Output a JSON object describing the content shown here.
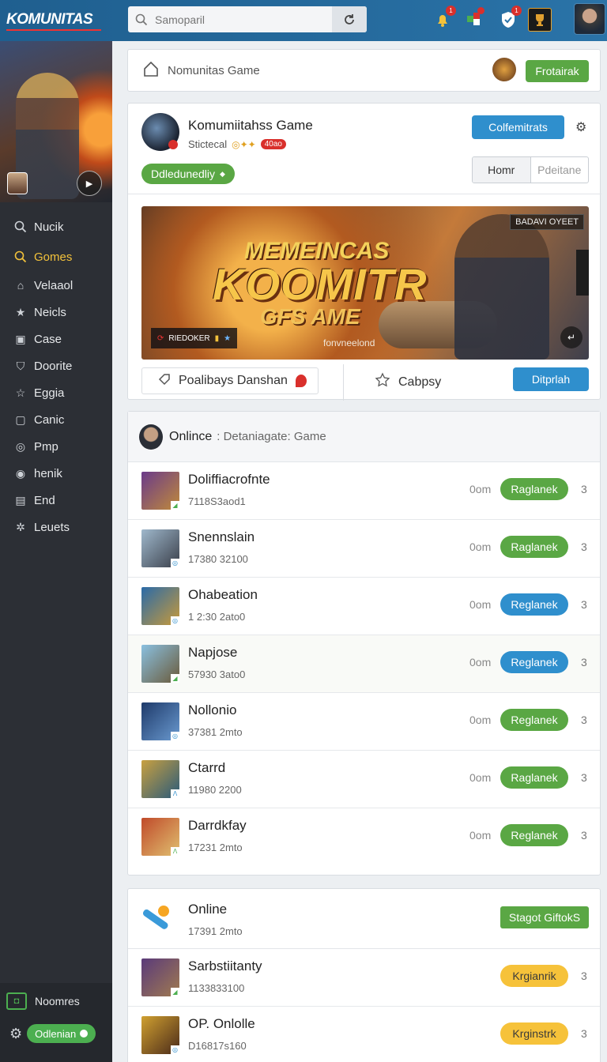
{
  "topbar": {
    "logo": "KOMUNITAS",
    "search_placeholder": "Samoparil",
    "icons": [
      "bell-icon",
      "puzzle-icon",
      "shield-icon",
      "trophy-icon"
    ],
    "badges": [
      "1",
      "",
      "1",
      ""
    ]
  },
  "sidebar": {
    "items": [
      {
        "label": "Nucik",
        "icon": "search-icon"
      },
      {
        "label": "Gomes",
        "icon": "search-icon",
        "active": true
      },
      {
        "label": "Velaaol",
        "icon": "home-icon"
      },
      {
        "label": "Neicls",
        "icon": "star-icon"
      },
      {
        "label": "Case",
        "icon": "box-icon"
      },
      {
        "label": "Doorite",
        "icon": "shield-icon"
      },
      {
        "label": "Eggia",
        "icon": "star-outline-icon"
      },
      {
        "label": "Canic",
        "icon": "square-icon"
      },
      {
        "label": "Pmp",
        "icon": "circle-icon"
      },
      {
        "label": "henik",
        "icon": "circle-icon"
      },
      {
        "label": "End",
        "icon": "briefcase-icon"
      },
      {
        "label": "Leuets",
        "icon": "sparkle-icon"
      }
    ],
    "bottom_label": "Noomres",
    "status_label": "Odlenian"
  },
  "breadcrumb": {
    "title": "Nomunitas Game",
    "action_label": "Frotairak"
  },
  "game": {
    "title": "Komumiitahss Game",
    "subtitle": "Stictecal",
    "badge": "40ao",
    "follow_label": "Colfemitrats",
    "status_pill": "Ddledunedliy",
    "tabs": [
      "Homr",
      "Pdeitane"
    ],
    "banner": {
      "line1": "MEMEINCAS",
      "line2": "KOOMITR",
      "line3": "GFS AME",
      "tag": "BADAVI OYEET",
      "logo_strip": "RIEDOKER",
      "caption": "fonvneelond"
    },
    "foot_left": "Poalibays Danshan",
    "foot_mid": "Cabpsy",
    "foot_btn": "Ditprlah"
  },
  "list": {
    "title": "Onlince",
    "subtitle": ": Detaniagate: Game",
    "rows": [
      {
        "name": "Doliffiacrofnte",
        "sub": "7118S3aod1",
        "time": "0om",
        "button": "Raglanek",
        "color": "green",
        "count": "3"
      },
      {
        "name": "Snennslain",
        "sub": "17380 32100",
        "time": "0om",
        "button": "Raglanek",
        "color": "green",
        "count": "3"
      },
      {
        "name": "Ohabeation",
        "sub": "1 2:30 2ato0",
        "time": "0om",
        "button": "Reglanek",
        "color": "blue",
        "count": "3"
      },
      {
        "name": "Napjose",
        "sub": "57930 3ato0",
        "time": "0om",
        "button": "Reglanek",
        "color": "blue",
        "count": "3"
      },
      {
        "name": "Nollonio",
        "sub": "37381 2mto",
        "time": "0om",
        "button": "Reglanek",
        "color": "green",
        "count": "3"
      },
      {
        "name": "Ctarrd",
        "sub": "11980 2200",
        "time": "0om",
        "button": "Raglanek",
        "color": "green",
        "count": "3"
      },
      {
        "name": "Darrdkfay",
        "sub": "17231 2mto",
        "time": "0om",
        "button": "Reglanek",
        "color": "green",
        "count": "3"
      }
    ]
  },
  "online": {
    "title": "Online",
    "subtitle": "17391 2mto",
    "button": "Stagot GiftokS",
    "rows": [
      {
        "name": "Sarbstiitanty",
        "sub": "1133833100",
        "button": "Krgianrik",
        "count": "3"
      },
      {
        "name": "OP. Onlolle",
        "sub": "D16817s160",
        "button": "Krginstrk",
        "count": "3"
      }
    ]
  },
  "colors": {
    "topbar": "#2a73a8",
    "sidebar": "#2c2f35",
    "active": "#f3c23b",
    "green": "#5aa744",
    "blue": "#2f8fcd",
    "yellow": "#f6c23a"
  }
}
